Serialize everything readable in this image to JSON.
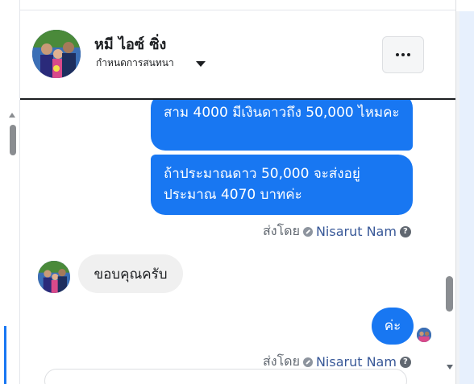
{
  "header": {
    "name": "หมี ไอซ์ ซิ่ง",
    "subtitle": "กำหนดการสนทนา",
    "more_icon": "more-horizontal-icon"
  },
  "messages": [
    {
      "direction": "out",
      "text": "สาม 4000 มีเงินดาวถึง 50,000 ไหมคะ"
    },
    {
      "direction": "out",
      "text": "ถ้าประมาณดาว 50,000 จะส่งอยู่ประมาณ 4070 บาทค่ะ"
    },
    {
      "direction": "in",
      "text": "ขอบคุณครับ"
    },
    {
      "direction": "out",
      "text": "ค่ะ"
    }
  ],
  "sent_by": {
    "label": "ส่งโดย",
    "name": "Nisarut Nam",
    "help": "?"
  },
  "colors": {
    "outgoing_bubble": "#1877f2",
    "incoming_bubble": "#f0f0f0",
    "sender_link": "#385898"
  }
}
